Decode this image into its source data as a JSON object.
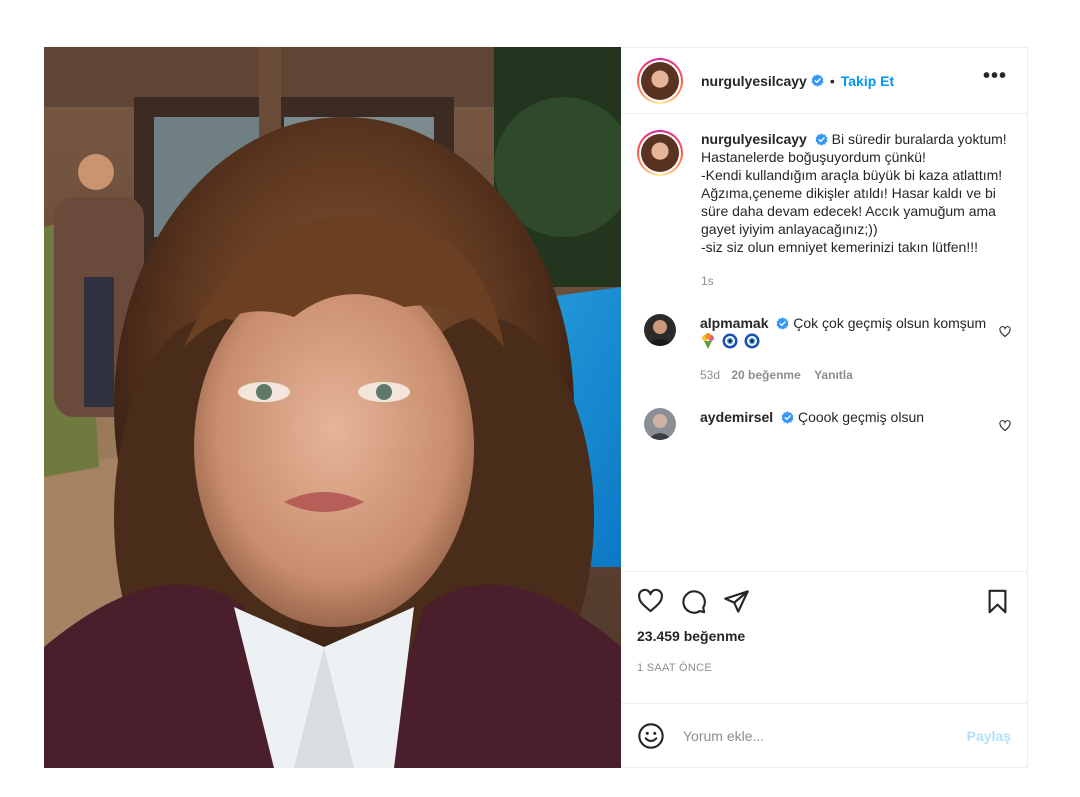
{
  "post": {
    "username": "nurgulyesilcayy",
    "follow_label": "Takip Et",
    "separator": "•",
    "more_label": "•••"
  },
  "caption": {
    "username": "nurgulyesilcayy",
    "text": "Bi süredir buralarda yoktum! Hastanelerde boğuşuyordum çünkü!\n-Kendi kullandığım araçla büyük bi kaza atlattım! Ağzıma,çeneme dikişler atıldı! Hasar kaldı ve bi süre daha devam edecek! Accık yamuğum ama gayet iyiyim anlayacağınız;))\n-siz siz olun emniyet kemerinizi takın lütfen!!!",
    "time": "1s"
  },
  "comments": [
    {
      "username": "alpmamak",
      "text": "Çok çok geçmiş olsun komşum",
      "emojis": [
        "bouquet-emoji",
        "nazar-emoji",
        "nazar-emoji"
      ],
      "time": "53d",
      "likes": "20 beğenme",
      "reply": "Yanıtla"
    },
    {
      "username": "aydemirsel",
      "text": "Çoook geçmiş olsun"
    }
  ],
  "actions": {
    "likes": "23.459 beğenme",
    "ago": "1 SAAT ÖNCE"
  },
  "add_comment": {
    "placeholder": "Yorum ekle...",
    "share_label": "Paylaş"
  },
  "colors": {
    "accent": "#0095f6",
    "share_disabled": "#b2dffc",
    "verified": "#3897f0"
  }
}
